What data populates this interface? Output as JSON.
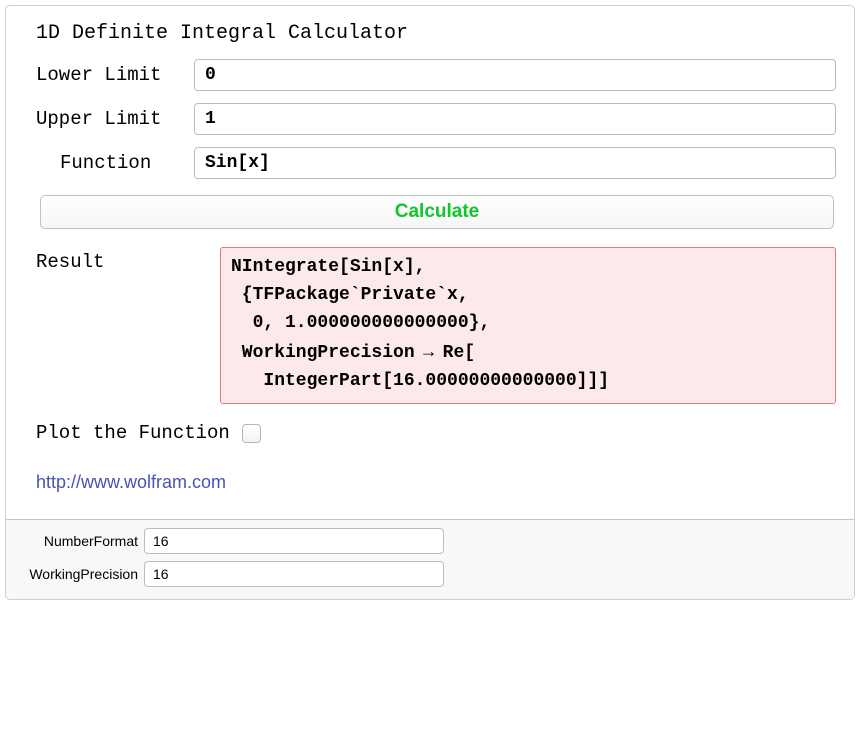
{
  "main": {
    "title": "1D Definite Integral Calculator",
    "lower_limit": {
      "label": "Lower Limit",
      "value": "0"
    },
    "upper_limit": {
      "label": "Upper Limit",
      "value": "1"
    },
    "function": {
      "label": "Function",
      "value": "Sin[x]"
    },
    "calculate_label": "Calculate",
    "result": {
      "label": "Result",
      "lines": {
        "l1": "NIntegrate[Sin[x],",
        "l2": " {TFPackage`Private`x,",
        "l3": "  0, 1.000000000000000},",
        "l4a": " WorkingPrecision",
        "l4b": "Re[",
        "l5": "   IntegerPart[16.00000000000000]]]"
      }
    },
    "plot": {
      "label": "Plot the Function",
      "checked": false
    },
    "link_text": "http://www.wolfram.com"
  },
  "bottom": {
    "number_format": {
      "label": "NumberFormat",
      "value": "16"
    },
    "working_precision": {
      "label": "WorkingPrecision",
      "value": "16"
    }
  }
}
